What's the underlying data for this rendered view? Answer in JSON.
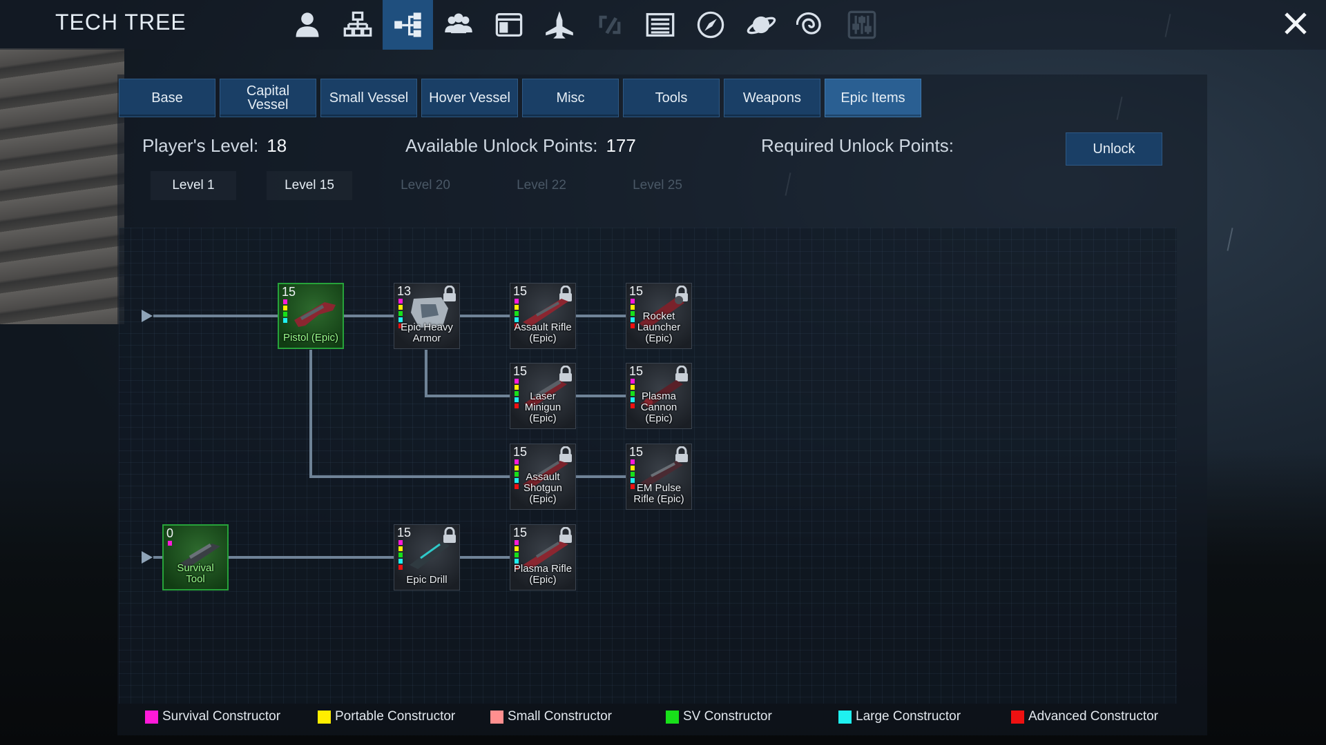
{
  "app": {
    "title": "TECH TREE"
  },
  "nav_icons": [
    "player-icon",
    "factory-icon",
    "tech-tree-icon",
    "faction-icon",
    "registry-icon",
    "spaceship-icon",
    "signal-icon",
    "logbook-icon",
    "compass-icon",
    "planet-icon",
    "galaxy-icon",
    "settings-icon"
  ],
  "tabs": [
    "Base",
    "Capital\nVessel",
    "Small Vessel",
    "Hover Vessel",
    "Misc",
    "Tools",
    "Weapons",
    "Epic Items"
  ],
  "active_tab": "Epic Items",
  "info": {
    "player_level_label": "Player's Level:",
    "player_level": "18",
    "available_label": "Available Unlock Points:",
    "available_points": "177",
    "required_label": "Required Unlock Points:",
    "unlock_label": "Unlock"
  },
  "levels": [
    {
      "label": "Level 1",
      "unlocked": true
    },
    {
      "label": "Level 15",
      "unlocked": true
    },
    {
      "label": "Level 20",
      "unlocked": false
    },
    {
      "label": "Level 22",
      "unlocked": false
    },
    {
      "label": "Level 25",
      "unlocked": false
    }
  ],
  "nodes": {
    "pistol": {
      "level": "15",
      "name": "Pistol (Epic)",
      "unlocked": true
    },
    "heavy_armor": {
      "level": "13",
      "name": "Epic Heavy\nArmor",
      "unlocked": false
    },
    "assault_rifle": {
      "level": "15",
      "name": "Assault Rifle\n(Epic)",
      "unlocked": false
    },
    "rocket": {
      "level": "15",
      "name": "Rocket\nLauncher\n(Epic)",
      "unlocked": false
    },
    "minigun": {
      "level": "15",
      "name": "Laser\nMinigun\n(Epic)",
      "unlocked": false
    },
    "plasma_cannon": {
      "level": "15",
      "name": "Plasma\nCannon\n(Epic)",
      "unlocked": false
    },
    "shotgun": {
      "level": "15",
      "name": "Assault\nShotgun\n(Epic)",
      "unlocked": false
    },
    "em_pulse": {
      "level": "15",
      "name": "EM Pulse\nRifle (Epic)",
      "unlocked": false
    },
    "survival_tool": {
      "level": "0",
      "name": "Survival\nTool",
      "unlocked": true
    },
    "epic_drill": {
      "level": "15",
      "name": "Epic Drill",
      "unlocked": false
    },
    "plasma_rifle": {
      "level": "15",
      "name": "Plasma Rifle\n(Epic)",
      "unlocked": false
    }
  },
  "legend": [
    {
      "label": "Survival Constructor",
      "color": "#ff1ad9"
    },
    {
      "label": "Portable Constructor",
      "color": "#ffee00"
    },
    {
      "label": "Small Constructor",
      "color": "#ff8f8f"
    },
    {
      "label": "SV Constructor",
      "color": "#18e01a"
    },
    {
      "label": "Large Constructor",
      "color": "#1ff0f0"
    },
    {
      "label": "Advanced Constructor",
      "color": "#ee1111"
    }
  ]
}
